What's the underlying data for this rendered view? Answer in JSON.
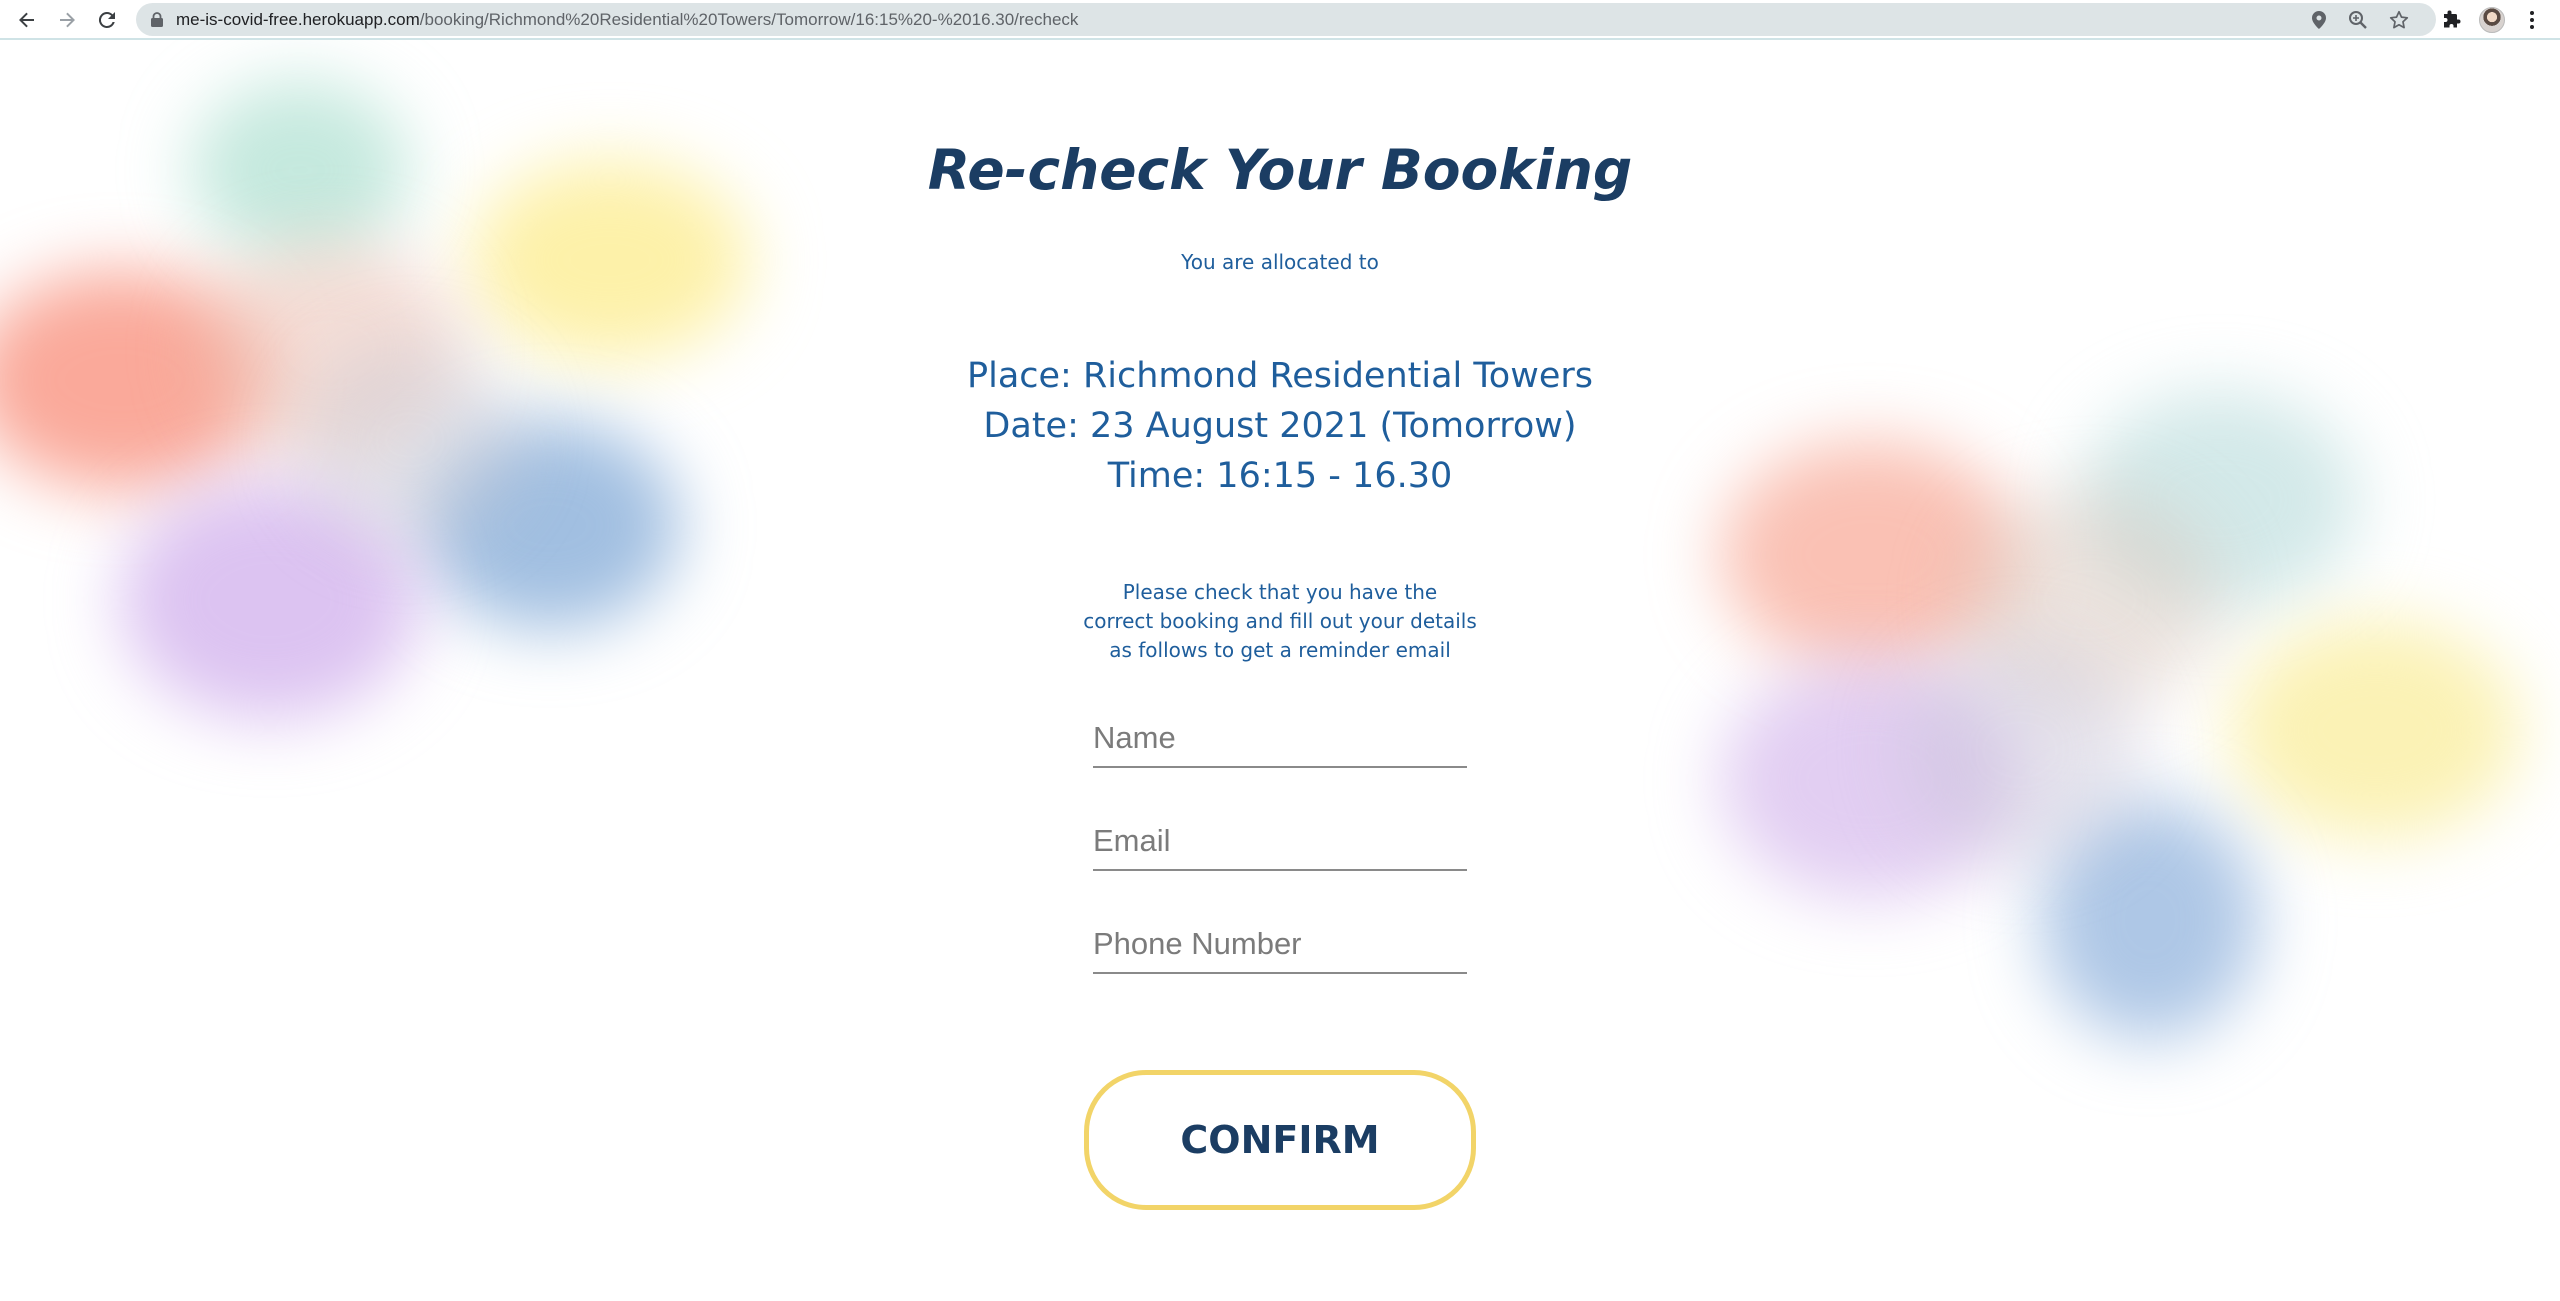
{
  "browser": {
    "url_host": "me-is-covid-free.herokuapp.com",
    "url_path": "/booking/Richmond%20Residential%20Towers/Tomorrow/16:15%20-%2016.30/recheck",
    "icons": [
      "back-icon",
      "forward-icon",
      "reload-icon",
      "lock-icon",
      "location-icon",
      "zoom-icon",
      "bookmark-star-icon",
      "extensions-icon",
      "profile-avatar",
      "menu-icon"
    ]
  },
  "page": {
    "title": "Re-check Your Booking",
    "allocated_text": "You are allocated to",
    "place_line": "Place: Richmond Residential Towers",
    "date_line": "Date: 23 August 2021 (Tomorrow)",
    "time_line": "Time: 16:15 - 16.30",
    "instructions_lines": [
      "Please check that you have the",
      "correct booking and fill out your details",
      "as follows to get a reminder email"
    ],
    "form": {
      "name_placeholder": "Name",
      "name_value": "",
      "email_placeholder": "Email",
      "email_value": "",
      "phone_placeholder": "Phone Number",
      "phone_value": ""
    },
    "confirm_label": "CONFIRM"
  },
  "colors": {
    "title": "#1b3d63",
    "text": "#1f5e9c",
    "button_border": "#f2d468"
  }
}
